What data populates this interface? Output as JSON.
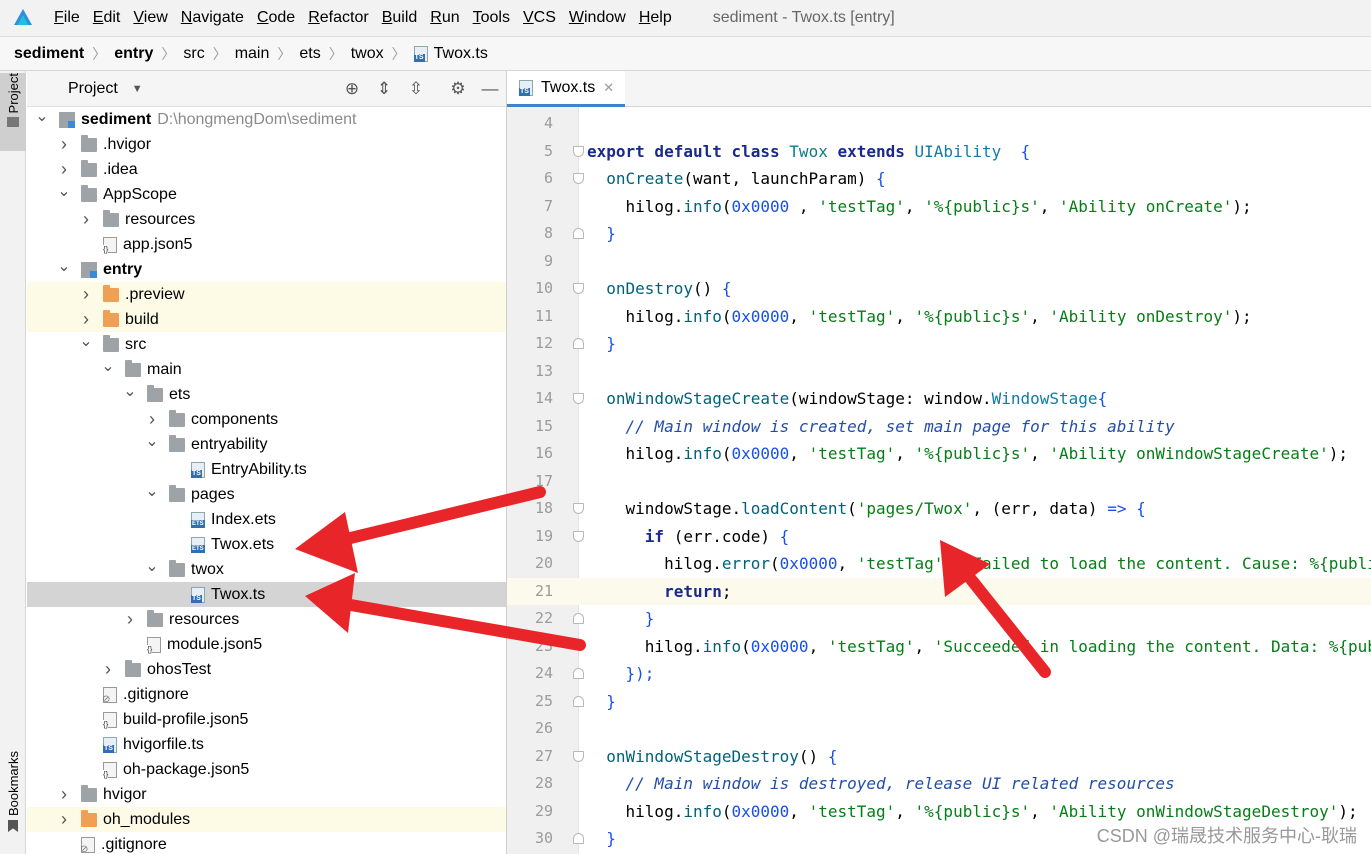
{
  "menubar": {
    "items": [
      {
        "mnemonic": "F",
        "rest": "ile"
      },
      {
        "mnemonic": "E",
        "rest": "dit"
      },
      {
        "mnemonic": "V",
        "rest": "iew"
      },
      {
        "mnemonic": "N",
        "rest": "avigate"
      },
      {
        "mnemonic": "C",
        "rest": "ode"
      },
      {
        "mnemonic": "R",
        "rest": "efactor"
      },
      {
        "mnemonic": "B",
        "rest": "uild"
      },
      {
        "mnemonic": "R",
        "rest": "un"
      },
      {
        "mnemonic": "T",
        "rest": "ools"
      },
      {
        "mnemonic": "V",
        "rest": "CS"
      },
      {
        "mnemonic": "W",
        "rest": "indow"
      },
      {
        "mnemonic": "H",
        "rest": "elp"
      }
    ],
    "window_title": "sediment - Twox.ts [entry]"
  },
  "breadcrumb": [
    "sediment",
    "entry",
    "src",
    "main",
    "ets",
    "twox",
    "Twox.ts"
  ],
  "left_stripe": {
    "project": "Project",
    "bookmarks": "Bookmarks"
  },
  "project_panel": {
    "title": "Project",
    "tree": [
      {
        "arrow": "down",
        "icon": "module",
        "name": "sediment",
        "bold": true,
        "path": "D:\\hongmengDom\\sediment",
        "indent": 0
      },
      {
        "arrow": "right",
        "icon": "folder",
        "name": ".hvigor",
        "indent": 1
      },
      {
        "arrow": "right",
        "icon": "folder",
        "name": ".idea",
        "indent": 1
      },
      {
        "arrow": "down",
        "icon": "folder",
        "name": "AppScope",
        "indent": 1
      },
      {
        "arrow": "right",
        "icon": "folder",
        "name": "resources",
        "indent": 2
      },
      {
        "arrow": "none",
        "icon": "json",
        "name": "app.json5",
        "indent": 2
      },
      {
        "arrow": "down",
        "icon": "module",
        "name": "entry",
        "bold": true,
        "indent": 1
      },
      {
        "arrow": "right",
        "icon": "folder-orange",
        "name": ".preview",
        "indent": 2,
        "highlight": true
      },
      {
        "arrow": "right",
        "icon": "folder-orange",
        "name": "build",
        "indent": 2,
        "highlight": true
      },
      {
        "arrow": "down",
        "icon": "folder",
        "name": "src",
        "indent": 2
      },
      {
        "arrow": "down",
        "icon": "folder",
        "name": "main",
        "indent": 3
      },
      {
        "arrow": "down",
        "icon": "folder",
        "name": "ets",
        "indent": 4
      },
      {
        "arrow": "right",
        "icon": "folder",
        "name": "components",
        "indent": 5
      },
      {
        "arrow": "down",
        "icon": "folder",
        "name": "entryability",
        "indent": 5
      },
      {
        "arrow": "none",
        "icon": "ts",
        "name": "EntryAbility.ts",
        "indent": 6
      },
      {
        "arrow": "down",
        "icon": "folder",
        "name": "pages",
        "indent": 5
      },
      {
        "arrow": "none",
        "icon": "ets",
        "name": "Index.ets",
        "indent": 6
      },
      {
        "arrow": "none",
        "icon": "ets",
        "name": "Twox.ets",
        "indent": 6
      },
      {
        "arrow": "down",
        "icon": "folder",
        "name": "twox",
        "indent": 5
      },
      {
        "arrow": "none",
        "icon": "ts",
        "name": "Twox.ts",
        "indent": 6,
        "selected": true
      },
      {
        "arrow": "right",
        "icon": "folder",
        "name": "resources",
        "indent": 4
      },
      {
        "arrow": "none",
        "icon": "json",
        "name": "module.json5",
        "indent": 4
      },
      {
        "arrow": "right",
        "icon": "folder",
        "name": "ohosTest",
        "indent": 3
      },
      {
        "arrow": "none",
        "icon": "git",
        "name": ".gitignore",
        "indent": 2
      },
      {
        "arrow": "none",
        "icon": "json",
        "name": "build-profile.json5",
        "indent": 2
      },
      {
        "arrow": "none",
        "icon": "ts",
        "name": "hvigorfile.ts",
        "indent": 2
      },
      {
        "arrow": "none",
        "icon": "json",
        "name": "oh-package.json5",
        "indent": 2
      },
      {
        "arrow": "right",
        "icon": "folder",
        "name": "hvigor",
        "indent": 1
      },
      {
        "arrow": "right",
        "icon": "folder-orange",
        "name": "oh_modules",
        "indent": 1,
        "highlight": true
      },
      {
        "arrow": "none",
        "icon": "git",
        "name": ".gitignore",
        "indent": 1
      }
    ]
  },
  "editor": {
    "tab_label": "Twox.ts",
    "current_line": 21,
    "lines": [
      {
        "n": "4",
        "tokens": []
      },
      {
        "n": "5",
        "fold": "open",
        "tokens": [
          [
            "kw",
            "export default class "
          ],
          [
            "cls",
            "Twox"
          ],
          [
            "kw",
            " extends "
          ],
          [
            "ty",
            "UIAbility"
          ],
          [
            "",
            "  "
          ],
          [
            "bl",
            "{"
          ]
        ]
      },
      {
        "n": "6",
        "fold": "open",
        "tokens": [
          [
            "",
            "  "
          ],
          [
            "fn",
            "onCreate"
          ],
          [
            "",
            "(want, launchParam) "
          ],
          [
            "bl",
            "{"
          ]
        ]
      },
      {
        "n": "7",
        "tokens": [
          [
            "",
            "    hilog."
          ],
          [
            "fn",
            "info"
          ],
          [
            "",
            "("
          ],
          [
            "num",
            "0x0000"
          ],
          [
            "",
            " , "
          ],
          [
            "str",
            "'testTag'"
          ],
          [
            "",
            ", "
          ],
          [
            "str",
            "'%{public}s'"
          ],
          [
            "",
            ", "
          ],
          [
            "str",
            "'Ability onCreate'"
          ],
          [
            "",
            ");"
          ]
        ]
      },
      {
        "n": "8",
        "fold": "close",
        "tokens": [
          [
            "",
            "  "
          ],
          [
            "bl",
            "}"
          ]
        ]
      },
      {
        "n": "9",
        "tokens": []
      },
      {
        "n": "10",
        "fold": "open",
        "tokens": [
          [
            "",
            "  "
          ],
          [
            "fn",
            "onDestroy"
          ],
          [
            "",
            "() "
          ],
          [
            "bl",
            "{"
          ]
        ]
      },
      {
        "n": "11",
        "tokens": [
          [
            "",
            "    hilog."
          ],
          [
            "fn",
            "info"
          ],
          [
            "",
            "("
          ],
          [
            "num",
            "0x0000"
          ],
          [
            "",
            ", "
          ],
          [
            "str",
            "'testTag'"
          ],
          [
            "",
            ", "
          ],
          [
            "str",
            "'%{public}s'"
          ],
          [
            "",
            ", "
          ],
          [
            "str",
            "'Ability onDestroy'"
          ],
          [
            "",
            ");"
          ]
        ]
      },
      {
        "n": "12",
        "fold": "close",
        "tokens": [
          [
            "",
            "  "
          ],
          [
            "bl",
            "}"
          ]
        ]
      },
      {
        "n": "13",
        "tokens": []
      },
      {
        "n": "14",
        "fold": "open",
        "tokens": [
          [
            "",
            "  "
          ],
          [
            "fn",
            "onWindowStageCreate"
          ],
          [
            "",
            "(windowStage: window."
          ],
          [
            "ty",
            "WindowStage"
          ],
          [
            ") "
          ],
          [
            "bl",
            "{"
          ]
        ]
      },
      {
        "n": "15",
        "tokens": [
          [
            "",
            "    "
          ],
          [
            "cmt",
            "// Main window is created, set main page for this ability"
          ]
        ]
      },
      {
        "n": "16",
        "tokens": [
          [
            "",
            "    hilog."
          ],
          [
            "fn",
            "info"
          ],
          [
            "",
            "("
          ],
          [
            "num",
            "0x0000"
          ],
          [
            "",
            ", "
          ],
          [
            "str",
            "'testTag'"
          ],
          [
            "",
            ", "
          ],
          [
            "str",
            "'%{public}s'"
          ],
          [
            "",
            ", "
          ],
          [
            "str",
            "'Ability onWindowStageCreate'"
          ],
          [
            "",
            ");"
          ]
        ]
      },
      {
        "n": "17",
        "tokens": []
      },
      {
        "n": "18",
        "fold": "open",
        "tokens": [
          [
            "",
            "    windowStage."
          ],
          [
            "fn",
            "loadContent"
          ],
          [
            "",
            "("
          ],
          [
            "str",
            "'pages/Twox'"
          ],
          [
            "",
            ", (err, data) "
          ],
          [
            "bl",
            "=> {"
          ]
        ]
      },
      {
        "n": "19",
        "fold": "open",
        "tokens": [
          [
            "",
            "      "
          ],
          [
            "kw",
            "if"
          ],
          [
            "",
            " (err.code) "
          ],
          [
            "bl",
            "{"
          ]
        ]
      },
      {
        "n": "20",
        "tokens": [
          [
            "",
            "        hilog."
          ],
          [
            "fn",
            "error"
          ],
          [
            "",
            "("
          ],
          [
            "num",
            "0x0000"
          ],
          [
            "",
            ", "
          ],
          [
            "str",
            "'testTag'"
          ],
          [
            "",
            ", "
          ],
          [
            "str",
            "'Failed to load the content. Cause: %{public}s'"
          ]
        ]
      },
      {
        "n": "21",
        "tokens": [
          [
            "",
            "        "
          ],
          [
            "kw",
            "return"
          ],
          [
            "",
            ";"
          ]
        ]
      },
      {
        "n": "22",
        "fold": "close",
        "tokens": [
          [
            "",
            "      "
          ],
          [
            "bl",
            "}"
          ]
        ]
      },
      {
        "n": "23",
        "tokens": [
          [
            "",
            "      hilog."
          ],
          [
            "fn",
            "info"
          ],
          [
            "",
            "("
          ],
          [
            "num",
            "0x0000"
          ],
          [
            "",
            ", "
          ],
          [
            "str",
            "'testTag'"
          ],
          [
            "",
            ", "
          ],
          [
            "str",
            "'Succeeded in loading the content. Data: %{public}s'"
          ]
        ]
      },
      {
        "n": "24",
        "fold": "close",
        "tokens": [
          [
            "",
            "    "
          ],
          [
            "bl",
            "});"
          ]
        ]
      },
      {
        "n": "25",
        "fold": "close",
        "tokens": [
          [
            "",
            "  "
          ],
          [
            "bl",
            "}"
          ]
        ]
      },
      {
        "n": "26",
        "tokens": []
      },
      {
        "n": "27",
        "fold": "open",
        "tokens": [
          [
            "",
            "  "
          ],
          [
            "fn",
            "onWindowStageDestroy"
          ],
          [
            "",
            "() "
          ],
          [
            "bl",
            "{"
          ]
        ]
      },
      {
        "n": "28",
        "tokens": [
          [
            "",
            "    "
          ],
          [
            "cmt",
            "// Main window is destroyed, release UI related resources"
          ]
        ]
      },
      {
        "n": "29",
        "tokens": [
          [
            "",
            "    hilog."
          ],
          [
            "fn",
            "info"
          ],
          [
            "",
            "("
          ],
          [
            "num",
            "0x0000"
          ],
          [
            "",
            ", "
          ],
          [
            "str",
            "'testTag'"
          ],
          [
            "",
            ", "
          ],
          [
            "str",
            "'%{public}s'"
          ],
          [
            "",
            ", "
          ],
          [
            "str",
            "'Ability onWindowStageDestroy'"
          ],
          [
            "",
            ");"
          ]
        ]
      },
      {
        "n": "30",
        "fold": "close",
        "tokens": [
          [
            "",
            "  "
          ],
          [
            "bl",
            "}"
          ]
        ]
      }
    ]
  },
  "watermark": "CSDN @瑞晟技术服务中心-耿瑞",
  "colors": {
    "annotation_arrow": "#e8262a",
    "tab_underline": "#4083c9",
    "selection": "#d4d4d4"
  }
}
